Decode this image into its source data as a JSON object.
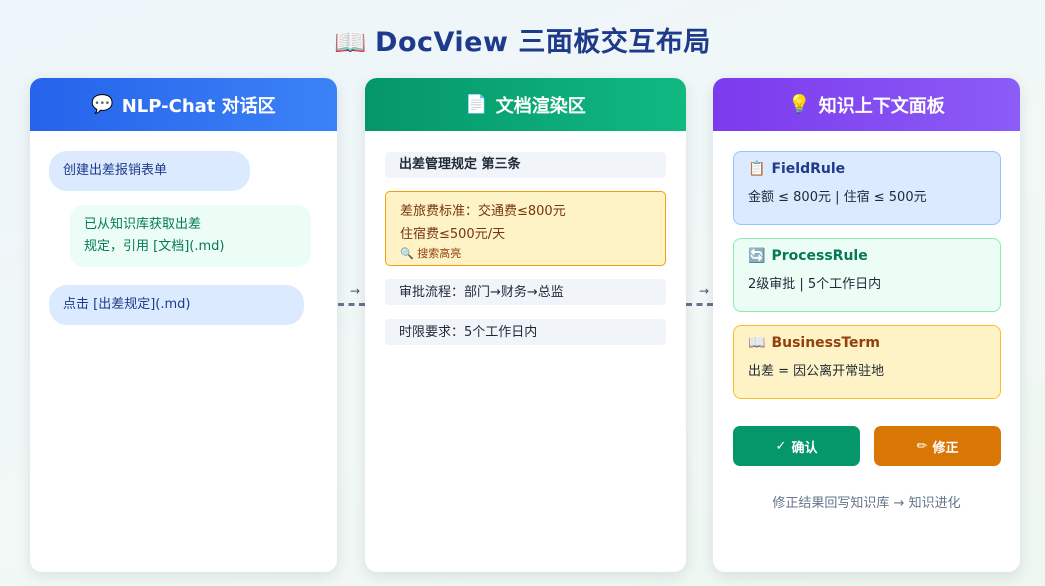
{
  "page": {
    "title": "DocView 三面板交互布局",
    "title_icon": "📖"
  },
  "chat_panel": {
    "icon": "💬",
    "title": "NLP-Chat 对话区",
    "messages": [
      {
        "role": "user",
        "text": "创建出差报销表单"
      },
      {
        "role": "bot",
        "line1": "已从知识库获取出差",
        "line2": "规定，引用 [文档](.md)"
      },
      {
        "role": "user",
        "text": "点击 [出差规定](.md)"
      }
    ]
  },
  "connectors": {
    "arrow": "→"
  },
  "doc_panel": {
    "icon": "📄",
    "title": "文档渲染区",
    "section_title": "出差管理规定 第三条",
    "highlight": {
      "line1": "差旅费标准：交通费≤800元",
      "line2": "住宿费≤500元/天",
      "note_icon": "🔍",
      "note": "搜索高亮"
    },
    "approval": "审批流程：部门→财务→总监",
    "deadline": "时限要求：5个工作日内"
  },
  "context_panel": {
    "icon": "💡",
    "title": "知识上下文面板",
    "cards": [
      {
        "icon": "📋",
        "title": "FieldRule",
        "body": "金额 ≤ 800元 | 住宿 ≤ 500元"
      },
      {
        "icon": "🔄",
        "title": "ProcessRule",
        "body": "2级审批 | 5个工作日内"
      },
      {
        "icon": "📖",
        "title": "BusinessTerm",
        "body": "出差 = 因公离开常驻地"
      }
    ],
    "confirm_icon": "✓",
    "confirm_label": "确认",
    "fix_icon": "✏",
    "fix_label": "修正",
    "footnote": "修正结果回写知识库 → 知识进化"
  },
  "colors": {
    "chat_header": "#2563eb",
    "doc_header": "#059669",
    "context_header": "#7c3aed",
    "confirm": "#059669",
    "fix": "#d97706"
  }
}
